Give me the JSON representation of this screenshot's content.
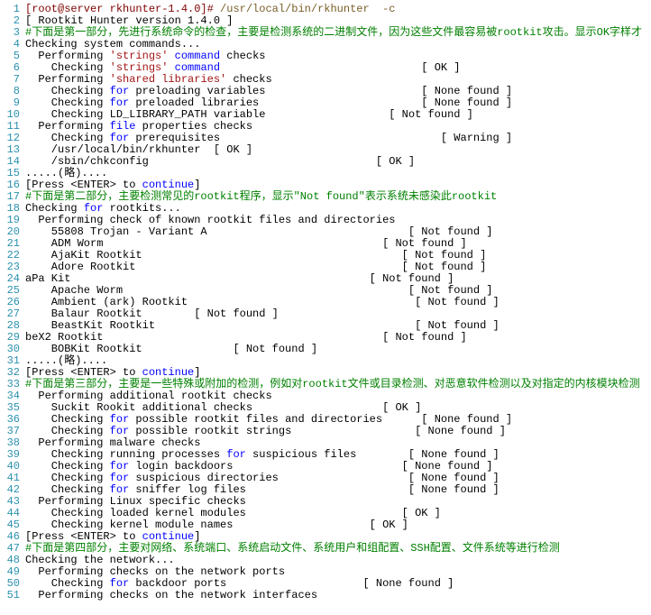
{
  "lines": [
    {
      "t": [
        [
          "prompt",
          "[root@server rkhunter-1.4.0]# "
        ],
        [
          "cmd",
          "/usr/local/bin/rkhunter  -c"
        ]
      ]
    },
    {
      "t": [
        [
          "plain",
          "[ Rootkit Hunter version 1.4.0 ]"
        ]
      ]
    },
    {
      "t": [
        [
          "comment",
          "#下面是第一部分，先进行系统命令的检查，主要是检测系统的二进制文件，因为这些文件最容易被rootkit攻击。显示OK字样才"
        ]
      ]
    },
    {
      "t": [
        [
          "plain",
          "Checking system commands..."
        ]
      ]
    },
    {
      "t": [
        [
          "plain",
          "  Performing "
        ],
        [
          "str",
          "'strings'"
        ],
        [
          "plain",
          " "
        ],
        [
          "kw",
          "command"
        ],
        [
          "plain",
          " checks"
        ]
      ]
    },
    {
      "t": [
        [
          "plain",
          "    Checking "
        ],
        [
          "str",
          "'strings'"
        ],
        [
          "plain",
          " "
        ],
        [
          "kw",
          "command"
        ],
        [
          "plain",
          "                               [ OK ]"
        ]
      ]
    },
    {
      "t": [
        [
          "plain",
          "  Performing "
        ],
        [
          "str",
          "'shared libraries'"
        ],
        [
          "plain",
          " checks"
        ]
      ]
    },
    {
      "t": [
        [
          "plain",
          "    Checking "
        ],
        [
          "kw",
          "for"
        ],
        [
          "plain",
          " preloading variables                        [ None found ]"
        ]
      ]
    },
    {
      "t": [
        [
          "plain",
          "    Checking "
        ],
        [
          "kw",
          "for"
        ],
        [
          "plain",
          " preloaded libraries                         [ None found ]"
        ]
      ]
    },
    {
      "t": [
        [
          "plain",
          "    Checking LD_LIBRARY_PATH variable                   [ Not found ]"
        ]
      ]
    },
    {
      "t": [
        [
          "plain",
          "  Performing "
        ],
        [
          "kw",
          "file"
        ],
        [
          "plain",
          " properties checks"
        ]
      ]
    },
    {
      "t": [
        [
          "plain",
          "    Checking "
        ],
        [
          "kw",
          "for"
        ],
        [
          "plain",
          " prerequisites                                  [ Warning ]"
        ]
      ]
    },
    {
      "t": [
        [
          "plain",
          "    /usr/local/bin/rkhunter  [ OK ]"
        ]
      ]
    },
    {
      "t": [
        [
          "plain",
          "    /sbin/chkconfig                                   [ OK ]"
        ]
      ]
    },
    {
      "t": [
        [
          "plain",
          ".....(略)...."
        ]
      ]
    },
    {
      "t": [
        [
          "plain",
          "[Press <ENTER> to "
        ],
        [
          "kw",
          "continue"
        ],
        [
          "plain",
          "]"
        ]
      ]
    },
    {
      "t": [
        [
          "comment",
          "#下面是第二部分，主要检测常见的rootkit程序，显示\"Not found\"表示系统未感染此rootkit"
        ]
      ]
    },
    {
      "t": [
        [
          "plain",
          "Checking "
        ],
        [
          "kw",
          "for"
        ],
        [
          "plain",
          " rootkits..."
        ]
      ]
    },
    {
      "t": [
        [
          "plain",
          "  Performing check of known rootkit files and directories"
        ]
      ]
    },
    {
      "t": [
        [
          "plain",
          "    55808 Trojan - Variant A                               [ Not found ]"
        ]
      ]
    },
    {
      "t": [
        [
          "plain",
          "    ADM Worm                                           [ Not found ]"
        ]
      ]
    },
    {
      "t": [
        [
          "plain",
          "    AjaKit Rootkit                                        [ Not found ]"
        ]
      ]
    },
    {
      "t": [
        [
          "plain",
          "    Adore Rootkit                                         [ Not found ]"
        ]
      ]
    },
    {
      "t": [
        [
          "plain",
          "aPa Kit                                              [ Not found ]"
        ]
      ]
    },
    {
      "t": [
        [
          "plain",
          "    Apache Worm                                            [ Not found ]"
        ]
      ]
    },
    {
      "t": [
        [
          "plain",
          "    Ambient (ark) Rootkit                                   [ Not found ]"
        ]
      ]
    },
    {
      "t": [
        [
          "plain",
          "    Balaur Rootkit        [ Not found ]"
        ]
      ]
    },
    {
      "t": [
        [
          "plain",
          "    BeastKit Rootkit                                        [ Not found ]"
        ]
      ]
    },
    {
      "t": [
        [
          "plain",
          "beX2 Rootkit                                           [ Not found ]"
        ]
      ]
    },
    {
      "t": [
        [
          "plain",
          "    BOBKit Rootkit              [ Not found ]"
        ]
      ]
    },
    {
      "t": [
        [
          "plain",
          ".....(略)...."
        ]
      ]
    },
    {
      "t": [
        [
          "plain",
          "[Press <ENTER> to "
        ],
        [
          "kw",
          "continue"
        ],
        [
          "plain",
          "]"
        ]
      ]
    },
    {
      "t": [
        [
          "comment",
          "#下面是第三部分，主要是一些特殊或附加的检测，例如对rootkit文件或目录检测、对恶意软件检测以及对指定的内核模块检测"
        ]
      ]
    },
    {
      "t": [
        [
          "plain",
          "  Performing additional rootkit checks"
        ]
      ]
    },
    {
      "t": [
        [
          "plain",
          "    Suckit Rookit additional checks                    [ OK ]"
        ]
      ]
    },
    {
      "t": [
        [
          "plain",
          "    Checking "
        ],
        [
          "kw",
          "for"
        ],
        [
          "plain",
          " possible rootkit files and directories      [ None found ]"
        ]
      ]
    },
    {
      "t": [
        [
          "plain",
          "    Checking "
        ],
        [
          "kw",
          "for"
        ],
        [
          "plain",
          " possible rootkit strings                   [ None found ]"
        ]
      ]
    },
    {
      "t": [
        [
          "plain",
          "  Performing malware checks"
        ]
      ]
    },
    {
      "t": [
        [
          "plain",
          "    Checking running processes "
        ],
        [
          "kw",
          "for"
        ],
        [
          "plain",
          " suspicious files        [ None found ]"
        ]
      ]
    },
    {
      "t": [
        [
          "plain",
          "    Checking "
        ],
        [
          "kw",
          "for"
        ],
        [
          "plain",
          " login backdoors                          [ None found ]"
        ]
      ]
    },
    {
      "t": [
        [
          "plain",
          "    Checking "
        ],
        [
          "kw",
          "for"
        ],
        [
          "plain",
          " suspicious directories                    [ None found ]"
        ]
      ]
    },
    {
      "t": [
        [
          "plain",
          "    Checking "
        ],
        [
          "kw",
          "for"
        ],
        [
          "plain",
          " sniffer log files                         [ None found ]"
        ]
      ]
    },
    {
      "t": [
        [
          "plain",
          "  Performing Linux specific checks"
        ]
      ]
    },
    {
      "t": [
        [
          "plain",
          "    Checking loaded kernel modules                        [ OK ]"
        ]
      ]
    },
    {
      "t": [
        [
          "plain",
          "    Checking kernel module names                     [ OK ]"
        ]
      ]
    },
    {
      "t": [
        [
          "plain",
          "[Press <ENTER> to "
        ],
        [
          "kw",
          "continue"
        ],
        [
          "plain",
          "]"
        ]
      ]
    },
    {
      "t": [
        [
          "comment",
          "#下面是第四部分，主要对网络、系统端口、系统启动文件、系统用户和组配置、SSH配置、文件系统等进行检测"
        ]
      ]
    },
    {
      "t": [
        [
          "plain",
          "Checking the network..."
        ]
      ]
    },
    {
      "t": [
        [
          "plain",
          "  Performing checks on the network ports"
        ]
      ]
    },
    {
      "t": [
        [
          "plain",
          "    Checking "
        ],
        [
          "kw",
          "for"
        ],
        [
          "plain",
          " backdoor ports                     [ None found ]"
        ]
      ]
    },
    {
      "t": [
        [
          "plain",
          "  Performing checks on the network interfaces"
        ]
      ]
    }
  ]
}
